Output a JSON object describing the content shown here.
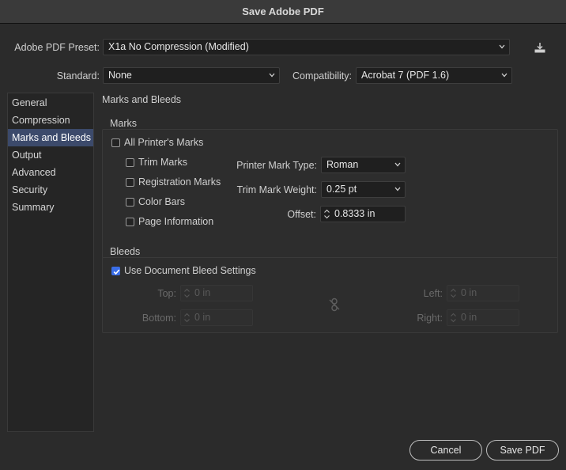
{
  "window": {
    "title": "Save Adobe PDF"
  },
  "preset": {
    "label": "Adobe PDF Preset:",
    "value": "X1a No Compression (Modified)"
  },
  "standard": {
    "label": "Standard:",
    "value": "None"
  },
  "compatibility": {
    "label": "Compatibility:",
    "value": "Acrobat 7 (PDF 1.6)"
  },
  "sidebar": {
    "items": [
      {
        "label": "General",
        "active": false
      },
      {
        "label": "Compression",
        "active": false
      },
      {
        "label": "Marks and Bleeds",
        "active": true
      },
      {
        "label": "Output",
        "active": false
      },
      {
        "label": "Advanced",
        "active": false
      },
      {
        "label": "Security",
        "active": false
      },
      {
        "label": "Summary",
        "active": false
      }
    ]
  },
  "panel": {
    "title": "Marks and Bleeds"
  },
  "marks": {
    "title": "Marks",
    "all_printers_marks": {
      "label": "All Printer's Marks",
      "checked": false
    },
    "trim_marks": {
      "label": "Trim Marks",
      "checked": false
    },
    "registration_marks": {
      "label": "Registration Marks",
      "checked": false
    },
    "color_bars": {
      "label": "Color Bars",
      "checked": false
    },
    "page_information": {
      "label": "Page Information",
      "checked": false
    },
    "printer_mark_type": {
      "label": "Printer Mark Type:",
      "value": "Roman"
    },
    "trim_mark_weight": {
      "label": "Trim Mark Weight:",
      "value": "0.25 pt"
    },
    "offset": {
      "label": "Offset:",
      "value": "0.8333 in"
    }
  },
  "bleeds": {
    "title": "Bleeds",
    "use_document_bleed": {
      "label": "Use Document Bleed Settings",
      "checked": true
    },
    "top": {
      "label": "Top:",
      "value": "0 in"
    },
    "bottom": {
      "label": "Bottom:",
      "value": "0 in"
    },
    "left": {
      "label": "Left:",
      "value": "0 in"
    },
    "right": {
      "label": "Right:",
      "value": "0 in"
    },
    "link_icon": "link-broken-icon"
  },
  "buttons": {
    "cancel": "Cancel",
    "save": "Save PDF"
  },
  "colors": {
    "accent": "#3a6ee8",
    "selection": "#3c4a6b"
  }
}
